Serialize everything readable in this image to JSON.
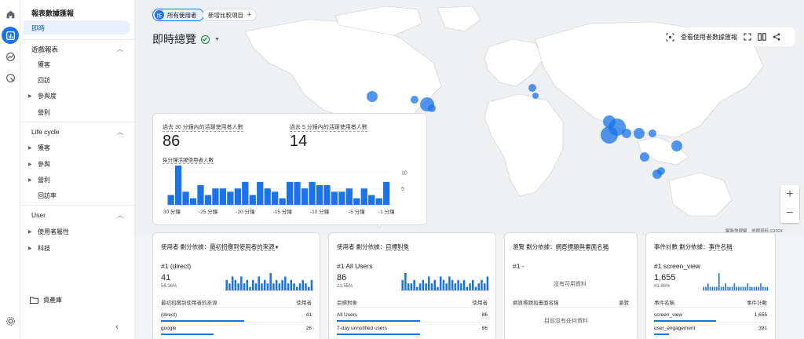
{
  "rail": {
    "icons": [
      "home-icon",
      "reports-icon",
      "explore-icon",
      "advertising-icon",
      "settings-icon"
    ]
  },
  "sidebar": {
    "title": "報表數據匯報",
    "active_item": "即時",
    "sections": [
      {
        "label": "遊戲報表",
        "items": [
          "獲客",
          "回訪",
          "參與度",
          "營利"
        ],
        "expandable": [
          false,
          false,
          true,
          false
        ]
      },
      {
        "label": "Life cycle",
        "items": [
          "獲客",
          "參與",
          "營利",
          "回訪率"
        ],
        "expandable": [
          true,
          true,
          true,
          false
        ]
      },
      {
        "label": "User",
        "items": [
          "使用者屬性",
          "科技"
        ],
        "expandable": [
          true,
          true
        ]
      }
    ],
    "library": "資產庫"
  },
  "header": {
    "chip_all_avatar": "所",
    "chip_all": "所有使用者",
    "chip_add": "新增比較項目",
    "title": "即時總覽",
    "view_report": "查看使用者數據匯報"
  },
  "map": {
    "attribution": "鍵盤快捷鍵　地圖資料 ©2024　",
    "accent": "#1a73e8",
    "bubble": "#1a73e8"
  },
  "realtime": {
    "label_30": "過去 30 分鐘內的活躍使用者人數",
    "value_30": "86",
    "label_5": "過去 5 分鐘內的活躍使用者人數",
    "value_5": "14",
    "chart_label": "每分鐘活躍使用者人數"
  },
  "chart_data": {
    "type": "bar",
    "title": "",
    "categories": [
      "-30 分鐘",
      "-29",
      "-28",
      "-27",
      "-26",
      "-25 分鐘",
      "-24",
      "-23",
      "-22",
      "-21",
      "-20 分鐘",
      "-19",
      "-18",
      "-17",
      "-16",
      "-15 分鐘",
      "-14",
      "-13",
      "-12",
      "-11",
      "-10 分鐘",
      "-9",
      "-8",
      "-7",
      "-6",
      "-5 分鐘",
      "-4",
      "-3",
      "-2",
      "-1 分鐘"
    ],
    "tick_labels": [
      "-30 分鐘",
      "-25 分鐘",
      "-20 分鐘",
      "-15 分鐘",
      "-10 分鐘",
      "-5 分鐘",
      "-1 分鐘"
    ],
    "values": [
      3,
      12,
      4,
      2,
      6,
      3,
      5,
      5,
      4,
      5,
      7,
      3,
      7,
      5,
      4,
      2,
      7,
      7,
      5,
      7,
      6,
      6,
      4,
      4,
      5,
      2,
      5,
      3,
      2,
      7
    ],
    "ylim": [
      0,
      12
    ],
    "yticks": [
      5,
      10
    ],
    "grid": true,
    "color": "#1a73e8"
  },
  "cards": [
    {
      "head_prefix": "使用者 劃分依據：",
      "head_dim": "最初招攬到使用者的來源",
      "rank": "#1  (direct)",
      "value": "41",
      "pct": "56.16%",
      "col_left": "最初招攬到使用者的來源",
      "col_right": "使用者",
      "rows": [
        {
          "name": "(direct)",
          "value": "41",
          "share": 1.0
        },
        {
          "name": "google",
          "value": "26",
          "share": 0.63
        }
      ],
      "spark": [
        3,
        2,
        4,
        3,
        2,
        4,
        2,
        3,
        1,
        3,
        2,
        4,
        2,
        3,
        2,
        5,
        2,
        3,
        2,
        3,
        4,
        2,
        3,
        2,
        1,
        2,
        3,
        2,
        1,
        3
      ]
    },
    {
      "head_prefix": "使用者 劃分依據：",
      "head_dim": "目標對象",
      "rank": "#1  All Users",
      "value": "86",
      "pct": "21.55%",
      "col_left": "目標對象",
      "col_right": "使用者",
      "rows": [
        {
          "name": "All Users",
          "value": "86",
          "share": 1.0
        },
        {
          "name": "7-day unnotified users",
          "value": "86",
          "share": 1.0
        }
      ],
      "spark": [
        3,
        5,
        2,
        2,
        3,
        1,
        2,
        3,
        2,
        4,
        2,
        3,
        1,
        4,
        3,
        2,
        4,
        3,
        2,
        3,
        2,
        3,
        1,
        2,
        3,
        1,
        2,
        3,
        2,
        4
      ]
    },
    {
      "head_prefix": "瀏覽 劃分依據：",
      "head_dim": "網頁標題與畫面名稱",
      "rank": "#1  -",
      "no_data": "沒有可用資料",
      "col_left": "網頁標題與畫面名稱",
      "col_right": "瀏覽",
      "empty_table": "目前沒有任何資料"
    },
    {
      "head_prefix": "事件計數 劃分依據：",
      "head_dim": "事件名稱",
      "rank": "#1  screen_view",
      "value": "1,655",
      "pct": "41.86%",
      "col_left": "事件名稱",
      "col_right": "事件計數",
      "rows": [
        {
          "name": "screen_view",
          "value": "1,655",
          "share": 1.0
        },
        {
          "name": "user_engagement",
          "value": "391",
          "share": 0.24
        }
      ],
      "spark": [
        1,
        1,
        2,
        1,
        1,
        1,
        1,
        5,
        1,
        1,
        2,
        1,
        1,
        1,
        2,
        1,
        1,
        1,
        1,
        1,
        2,
        1,
        1,
        1,
        1,
        1,
        2,
        1,
        1,
        1
      ]
    }
  ]
}
